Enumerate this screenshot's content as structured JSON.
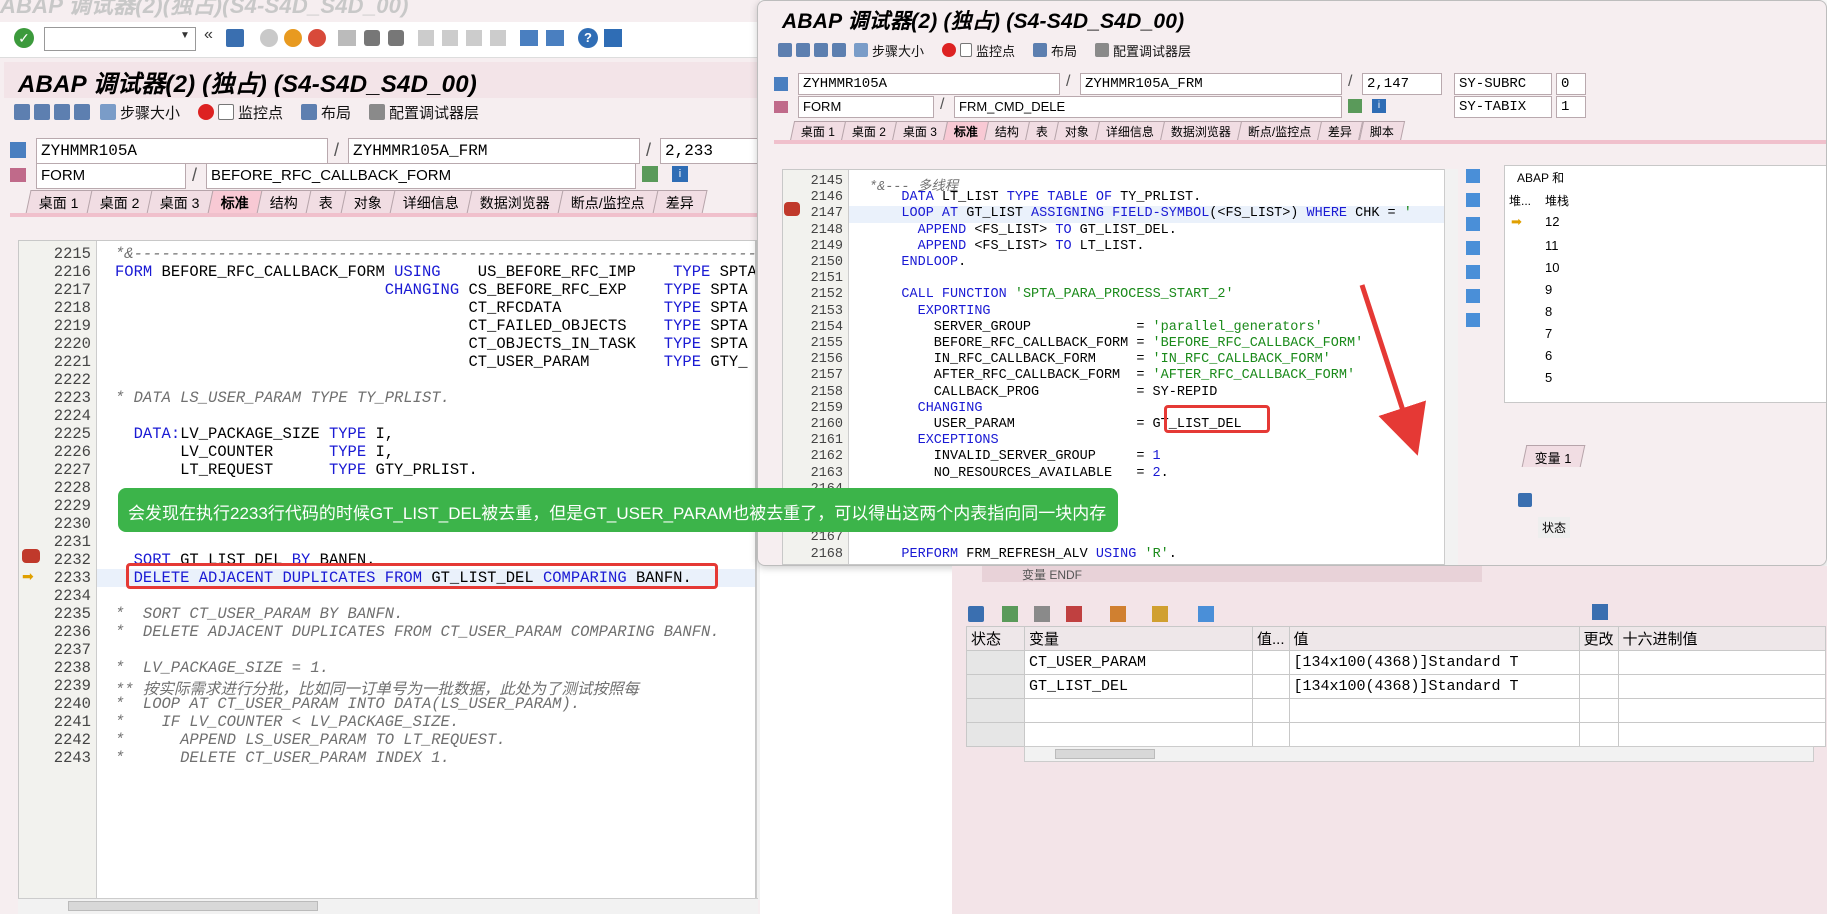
{
  "left_window": {
    "faded_title": "ABAP 调试器(2)(独占)(S4-S4D_S4D_00)",
    "title": "ABAP 调试器(2) (独占) (S4-S4D_S4D_00)",
    "toolbar_buttons": [
      "步骤大小",
      "监控点",
      "布局",
      "配置调试器层"
    ],
    "program_field": "ZYHMMR105A",
    "include_field": "ZYHMMR105A_FRM",
    "line_field": "2,233",
    "type_field": "FORM",
    "form_field": "BEFORE_RFC_CALLBACK_FORM",
    "tabs": [
      "桌面 1",
      "桌面 2",
      "桌面 3",
      "标准",
      "结构",
      "表",
      "对象",
      "详细信息",
      "数据浏览器",
      "断点/监控点",
      "差异"
    ],
    "active_tab": "标准",
    "code_lines": [
      {
        "n": "2215",
        "t": "*&-----------------------------------------------------------------------"
      },
      {
        "n": "2216",
        "t": "FORM BEFORE_RFC_CALLBACK_FORM USING    US_BEFORE_RFC_IMP    TYPE SPTA"
      },
      {
        "n": "2217",
        "t": "                             CHANGING CS_BEFORE_RFC_EXP    TYPE SPTA"
      },
      {
        "n": "2218",
        "t": "                                      CT_RFCDATA           TYPE SPTA"
      },
      {
        "n": "2219",
        "t": "                                      CT_FAILED_OBJECTS    TYPE SPTA"
      },
      {
        "n": "2220",
        "t": "                                      CT_OBJECTS_IN_TASK   TYPE SPTA"
      },
      {
        "n": "2221",
        "t": "                                      CT_USER_PARAM        TYPE GTY_"
      },
      {
        "n": "2222",
        "t": ""
      },
      {
        "n": "2223",
        "t": "* DATA LS_USER_PARAM TYPE TY_PRLIST."
      },
      {
        "n": "2224",
        "t": ""
      },
      {
        "n": "2225",
        "t": "  DATA:LV_PACKAGE_SIZE TYPE I,"
      },
      {
        "n": "2226",
        "t": "       LV_COUNTER      TYPE I,"
      },
      {
        "n": "2227",
        "t": "       LT_REQUEST      TYPE GTY_PRLIST."
      },
      {
        "n": "2228",
        "t": ""
      },
      {
        "n": "2229",
        "t": ""
      },
      {
        "n": "2230",
        "t": ""
      },
      {
        "n": "2231",
        "t": ""
      },
      {
        "n": "2232",
        "t": "  SORT GT_LIST_DEL BY BANFN."
      },
      {
        "n": "2233",
        "t": "  DELETE ADJACENT DUPLICATES FROM GT_LIST_DEL COMPARING BANFN."
      },
      {
        "n": "2234",
        "t": ""
      },
      {
        "n": "2235",
        "t": "*  SORT CT_USER_PARAM BY BANFN."
      },
      {
        "n": "2236",
        "t": "*  DELETE ADJACENT DUPLICATES FROM CT_USER_PARAM COMPARING BANFN."
      },
      {
        "n": "2237",
        "t": ""
      },
      {
        "n": "2238",
        "t": "*  LV_PACKAGE_SIZE = 1."
      },
      {
        "n": "2239",
        "t": "** 按实际需求进行分批，比如同一订单号为一批数据，此处为了测试按照每"
      },
      {
        "n": "2240",
        "t": "*  LOOP AT CT_USER_PARAM INTO DATA(LS_USER_PARAM)."
      },
      {
        "n": "2241",
        "t": "*    IF LV_COUNTER < LV_PACKAGE_SIZE."
      },
      {
        "n": "2242",
        "t": "*      APPEND LS_USER_PARAM TO LT_REQUEST."
      },
      {
        "n": "2243",
        "t": "*      DELETE CT_USER_PARAM INDEX 1."
      }
    ]
  },
  "right_window": {
    "title": "ABAP 调试器(2) (独占) (S4-S4D_S4D_00)",
    "toolbar_buttons": [
      "步骤大小",
      "监控点",
      "布局",
      "配置调试器层"
    ],
    "program_field": "ZYHMMR105A",
    "include_field": "ZYHMMR105A_FRM",
    "line_field": "2,147",
    "subrc_label": "SY-SUBRC",
    "subrc_value": "0",
    "type_field": "FORM",
    "form_field": "FRM_CMD_DELE",
    "tabix_label": "SY-TABIX",
    "tabix_value": "1",
    "tabs": [
      "桌面 1",
      "桌面 2",
      "桌面 3",
      "标准",
      "结构",
      "表",
      "对象",
      "详细信息",
      "数据浏览器",
      "断点/监控点",
      "差异",
      "脚本"
    ],
    "active_tab": "标准",
    "code_lines": [
      {
        "n": "2145",
        "t": "*&--- 多线程"
      },
      {
        "n": "2146",
        "t": "    DATA LT_LIST TYPE TABLE OF TY_PRLIST."
      },
      {
        "n": "2147",
        "t": "    LOOP AT GT_LIST ASSIGNING FIELD-SYMBOL(<FS_LIST>) WHERE CHK = '"
      },
      {
        "n": "2148",
        "t": "      APPEND <FS_LIST> TO GT_LIST_DEL."
      },
      {
        "n": "2149",
        "t": "      APPEND <FS_LIST> TO LT_LIST."
      },
      {
        "n": "2150",
        "t": "    ENDLOOP."
      },
      {
        "n": "2151",
        "t": ""
      },
      {
        "n": "2152",
        "t": "    CALL FUNCTION 'SPTA_PARA_PROCESS_START_2'"
      },
      {
        "n": "2153",
        "t": "      EXPORTING"
      },
      {
        "n": "2154",
        "t": "        SERVER_GROUP             = 'parallel_generators'"
      },
      {
        "n": "2155",
        "t": "        BEFORE_RFC_CALLBACK_FORM = 'BEFORE_RFC_CALLBACK_FORM'"
      },
      {
        "n": "2156",
        "t": "        IN_RFC_CALLBACK_FORM     = 'IN_RFC_CALLBACK_FORM'"
      },
      {
        "n": "2157",
        "t": "        AFTER_RFC_CALLBACK_FORM  = 'AFTER_RFC_CALLBACK_FORM'"
      },
      {
        "n": "2158",
        "t": "        CALLBACK_PROG            = SY-REPID"
      },
      {
        "n": "2159",
        "t": "      CHANGING"
      },
      {
        "n": "2160",
        "t": "        USER_PARAM               = GT_LIST_DEL"
      },
      {
        "n": "2161",
        "t": "      EXCEPTIONS"
      },
      {
        "n": "2162",
        "t": "        INVALID_SERVER_GROUP     = 1"
      },
      {
        "n": "2163",
        "t": "        NO_RESOURCES_AVAILABLE   = 2."
      },
      {
        "n": "2164",
        "t": ""
      },
      {
        "n": "2165",
        "t": ""
      },
      {
        "n": "2166",
        "t": ""
      },
      {
        "n": "2167",
        "t": ""
      },
      {
        "n": "2168",
        "t": "    PERFORM FRM_REFRESH_ALV USING 'R'."
      }
    ],
    "stack_header": "ABAP 和",
    "stack_col1": "堆...",
    "stack_col2": "堆栈",
    "stack_numbers": [
      "12",
      "11",
      "10",
      "9",
      "8",
      "7",
      "6",
      "5"
    ],
    "vars_tab": "变量 1",
    "status_col": "状态"
  },
  "variables_panel": {
    "headers": [
      "状态",
      "变量",
      "值...",
      "值",
      "更改",
      "十六进制值"
    ],
    "rows": [
      {
        "name": "CT_USER_PARAM",
        "value": "[134x100(4368)]Standard T"
      },
      {
        "name": "GT_LIST_DEL",
        "value": "[134x100(4368)]Standard T"
      }
    ],
    "behind_tab_label": "变量 ENDF"
  },
  "annotation": {
    "text": "会发现在执行2233行代码的时候GT_LIST_DEL被去重，但是GT_USER_PARAM也被去重了，可以得出这两个内表指向同一块内存"
  },
  "colors": {
    "annotation_bg": "#3cb44a",
    "highlight_box": "#e53935",
    "keyword": "#1a1ad4",
    "string": "#1a8a1a",
    "comment": "#707070",
    "window_pink": "#f3e4e8"
  }
}
